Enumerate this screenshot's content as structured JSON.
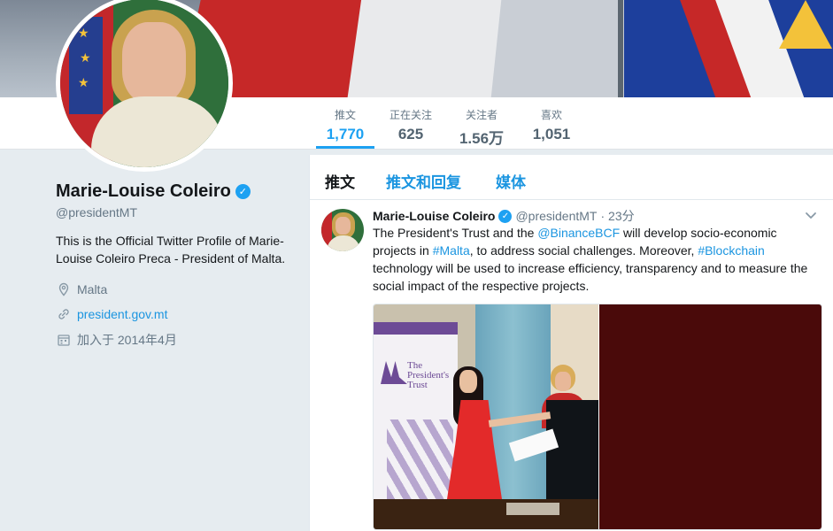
{
  "nav": {
    "stats": [
      {
        "label": "推文",
        "value": "1,770"
      },
      {
        "label": "正在关注",
        "value": "625"
      },
      {
        "label": "关注者",
        "value": "1.56万"
      },
      {
        "label": "喜欢",
        "value": "1,051"
      }
    ]
  },
  "profile": {
    "name": "Marie-Louise Coleiro",
    "handle": "@presidentMT",
    "bio": "This is the Official Twitter Profile of Marie-Louise Coleiro Preca - President of Malta.",
    "location": "Malta",
    "website": "president.gov.mt",
    "joined": "加入于 2014年4月"
  },
  "timeline": {
    "tabs": [
      "推文",
      "推文和回复",
      "媒体"
    ]
  },
  "tweet": {
    "name": "Marie-Louise Coleiro",
    "handle": "@presidentMT",
    "time": "· 23分",
    "text_parts": {
      "p1": "The President's Trust and the ",
      "mention": "@BinanceBCF",
      "p2": " will develop socio-economic projects in ",
      "hashtag1": "#Malta",
      "p3": ", to address social challenges. Moreover, ",
      "hashtag2": "#Blockchain",
      "p4": " technology will be used to increase efficiency, transparency and to measure the social impact of the respective projects."
    },
    "media_photo_text": "The President's Trust"
  },
  "colors": {
    "accent": "#1da1f2",
    "link": "#1b95e0",
    "background": "#e6ecf0"
  },
  "icons": [
    "verified-badge-icon",
    "location-pin-icon",
    "link-icon",
    "calendar-icon",
    "chevron-down-icon"
  ]
}
